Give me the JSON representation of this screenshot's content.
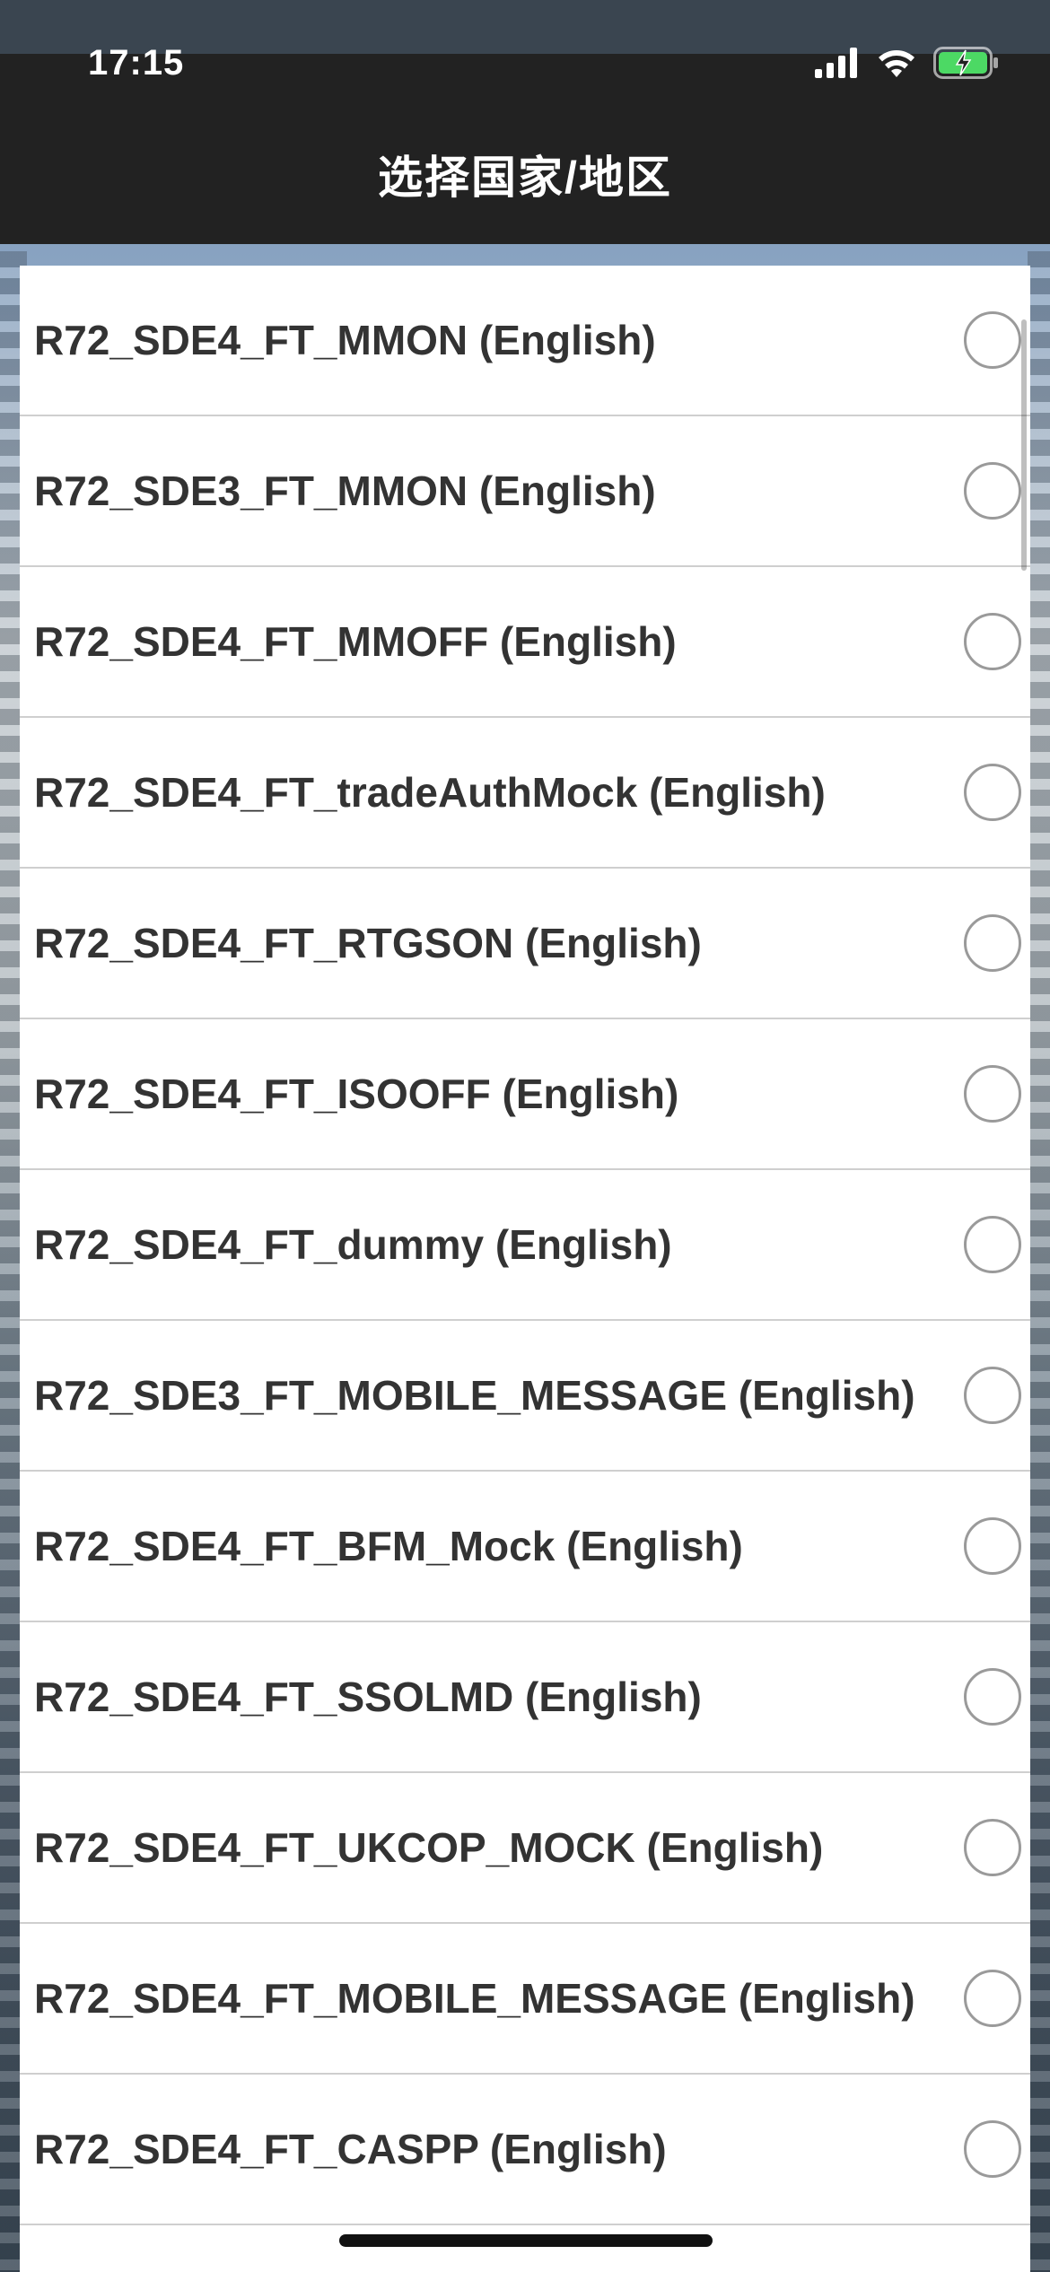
{
  "status_bar": {
    "time": "17:15",
    "icons": [
      "cellular-signal-icon",
      "wifi-icon",
      "battery-charging-icon"
    ]
  },
  "nav": {
    "title": "选择国家/地区"
  },
  "list": {
    "items": [
      {
        "label": "R72_SDE4_FT_MMON (English)",
        "selected": false
      },
      {
        "label": "R72_SDE3_FT_MMON (English)",
        "selected": false
      },
      {
        "label": "R72_SDE4_FT_MMOFF (English)",
        "selected": false
      },
      {
        "label": "R72_SDE4_FT_tradeAuthMock (English)",
        "selected": false
      },
      {
        "label": "R72_SDE4_FT_RTGSON (English)",
        "selected": false
      },
      {
        "label": "R72_SDE4_FT_ISOOFF (English)",
        "selected": false
      },
      {
        "label": "R72_SDE4_FT_dummy (English)",
        "selected": false
      },
      {
        "label": "R72_SDE3_FT_MOBILE_MESSAGE (English)",
        "selected": false
      },
      {
        "label": "R72_SDE4_FT_BFM_Mock (English)",
        "selected": false
      },
      {
        "label": "R72_SDE4_FT_SSOLMD (English)",
        "selected": false
      },
      {
        "label": "R72_SDE4_FT_UKCOP_MOCK (English)",
        "selected": false
      },
      {
        "label": "R72_SDE4_FT_MOBILE_MESSAGE (English)",
        "selected": false
      },
      {
        "label": "R72_SDE4_FT_CASPP (English)",
        "selected": false
      }
    ]
  },
  "colors": {
    "nav_background": "#222222",
    "battery_charging": "#4cd964",
    "radio_border": "#9a9a9a",
    "label_text": "#333333"
  }
}
